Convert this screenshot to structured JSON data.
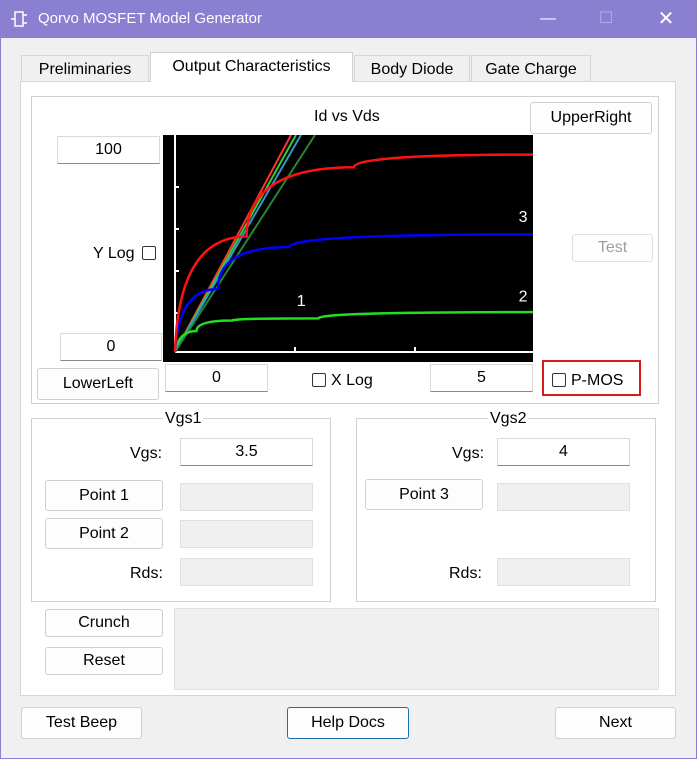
{
  "window": {
    "title": "Qorvo MOSFET Model Generator",
    "min_glyph": "—",
    "max_glyph": "☐",
    "close_glyph": "✕"
  },
  "tabs": [
    {
      "label": "Preliminaries"
    },
    {
      "label": "Output Characteristics"
    },
    {
      "label": "Body Diode"
    },
    {
      "label": "Gate Charge"
    }
  ],
  "chart_panel": {
    "title": "Id vs Vds",
    "upper_right_label": "UpperRight",
    "lower_left_label": "LowerLeft",
    "test_label": "Test",
    "y_max": "100",
    "y_min": "0",
    "x_min": "0",
    "x_max": "5",
    "y_log_label": "Y Log",
    "x_log_label": "X Log",
    "pmos_label": "P-MOS"
  },
  "chart_data": {
    "type": "line",
    "title": "Id vs Vds",
    "xlim": [
      0,
      5
    ],
    "ylim": [
      0,
      100
    ],
    "series": [
      {
        "color": "#22dd22",
        "values": [
          [
            0,
            0
          ],
          [
            0.3,
            10
          ],
          [
            0.8,
            15
          ],
          [
            2,
            16
          ],
          [
            5,
            19
          ]
        ]
      },
      {
        "color": "#0000ff",
        "values": [
          [
            0,
            0
          ],
          [
            0.6,
            30
          ],
          [
            1.6,
            50
          ],
          [
            5,
            56
          ]
        ]
      },
      {
        "color": "#ff1111",
        "values": [
          [
            0,
            0
          ],
          [
            1,
            55
          ],
          [
            2.5,
            88
          ],
          [
            5,
            94
          ]
        ]
      }
    ],
    "annotations": [
      {
        "text": "1",
        "x": 1.7,
        "y": 22
      },
      {
        "text": "2",
        "x": 4.8,
        "y": 24
      },
      {
        "text": "3",
        "x": 4.8,
        "y": 62
      }
    ]
  },
  "vgs1": {
    "title": "Vgs1",
    "vgs_label": "Vgs:",
    "vgs_value": "3.5",
    "point1_label": "Point 1",
    "point2_label": "Point 2",
    "rds_label": "Rds:"
  },
  "vgs2": {
    "title": "Vgs2",
    "vgs_label": "Vgs:",
    "vgs_value": "4",
    "point3_label": "Point 3",
    "rds_label": "Rds:"
  },
  "actions": {
    "crunch_label": "Crunch",
    "reset_label": "Reset"
  },
  "footer": {
    "test_beep_label": "Test Beep",
    "help_docs_label": "Help Docs",
    "next_label": "Next"
  }
}
